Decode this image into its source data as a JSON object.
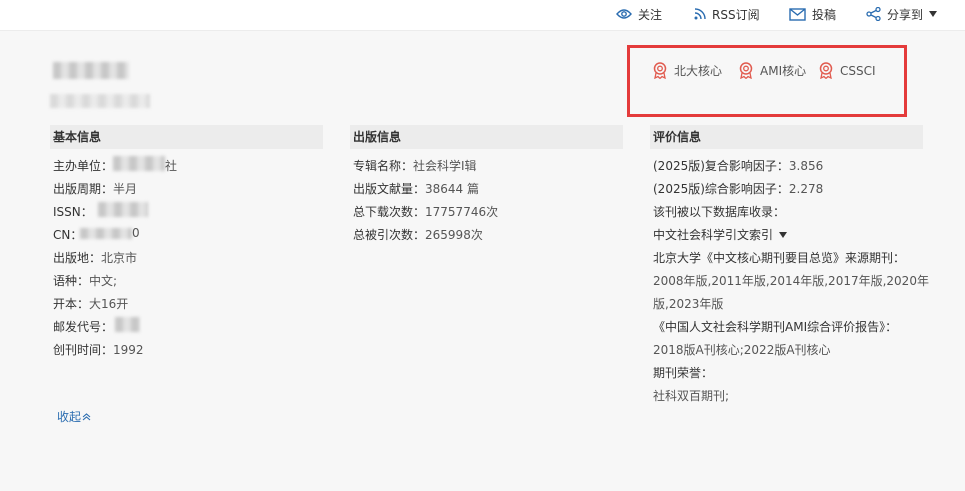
{
  "topbar": {
    "follow_label": "关注",
    "rss_label": "RSS订阅",
    "submit_label": "投稿",
    "share_label": "分享到"
  },
  "badges": [
    "北大核心",
    "AMI核心",
    "CSSCI"
  ],
  "basic": {
    "heading": "基本信息",
    "sponsor_label": "主办单位：",
    "sponsor_value_tail": "社",
    "cycle_label": "出版周期：",
    "cycle_value": "半月",
    "issn_label": "ISSN：",
    "cn_label": "CN：",
    "cn_value_tail": "0",
    "place_label": "出版地：",
    "place_value": "北京市",
    "lang_label": "语种：",
    "lang_value": "中文;",
    "format_label": "开本：",
    "format_value": "大16开",
    "postal_label": "邮发代号：",
    "founded_label": "创刊时间：",
    "founded_value": "1992"
  },
  "publish": {
    "heading": "出版信息",
    "series_label": "专辑名称：",
    "series_value": "社会科学Ⅰ辑",
    "docs_label": "出版文献量：",
    "docs_value": "38644 篇",
    "downloads_label": "总下载次数：",
    "downloads_value": "17757746次",
    "citations_label": "总被引次数：",
    "citations_value": "265998次"
  },
  "eval": {
    "heading": "评价信息",
    "composite_label": "(2025版)复合影响因子：",
    "composite_value": "3.856",
    "comprehensive_label": "(2025版)综合影响因子：",
    "comprehensive_value": "2.278",
    "db_label": "该刊被以下数据库收录：",
    "db_value": "中文社会科学引文索引",
    "pku_label": "北京大学《中文核心期刊要目总览》来源期刊：",
    "pku_years_line1": "2008年版,2011年版,2014年版,2017年版,2020年",
    "pku_years_line2": "版,2023年版",
    "ami_label": "《中国人文社会科学期刊AMI综合评价报告》：",
    "ami_value": "2018版A刊核心;2022版A刊核心",
    "honor_label": "期刊荣誉：",
    "honor_value": "社科双百期刊;"
  },
  "collapse_label": "收起"
}
